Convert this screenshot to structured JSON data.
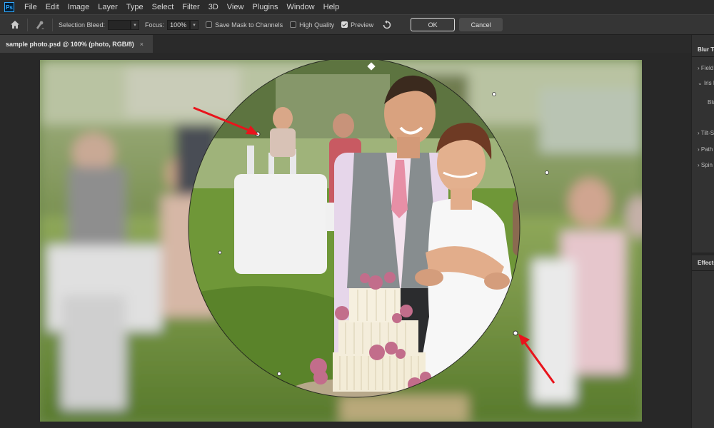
{
  "app": {
    "logo": "Ps"
  },
  "menu": [
    "File",
    "Edit",
    "Image",
    "Layer",
    "Type",
    "Select",
    "Filter",
    "3D",
    "View",
    "Plugins",
    "Window",
    "Help"
  ],
  "options": {
    "selection_bleed_label": "Selection Bleed:",
    "selection_bleed_value": "",
    "focus_label": "Focus:",
    "focus_value": "100%",
    "save_mask_label": "Save Mask to Channels",
    "save_mask_checked": false,
    "high_quality_label": "High Quality",
    "high_quality_checked": false,
    "preview_label": "Preview",
    "preview_checked": true,
    "ok_label": "OK",
    "cancel_label": "Cancel"
  },
  "document": {
    "tab_title": "sample photo.psd @ 100% (photo, RGB/8)",
    "close": "×"
  },
  "panel": {
    "title": "Blur Tools",
    "items": [
      "Field Blur",
      "Iris Blur",
      "Blur:",
      "Tilt-Shift",
      "Path Blur",
      "Spin Blur"
    ],
    "effects_title": "Effects"
  },
  "icons": {
    "home": "home-icon",
    "tool": "blur-tool-icon",
    "reset": "reset-icon"
  },
  "colors": {
    "accent": "#31a8ff",
    "arrow": "#e8141c"
  }
}
